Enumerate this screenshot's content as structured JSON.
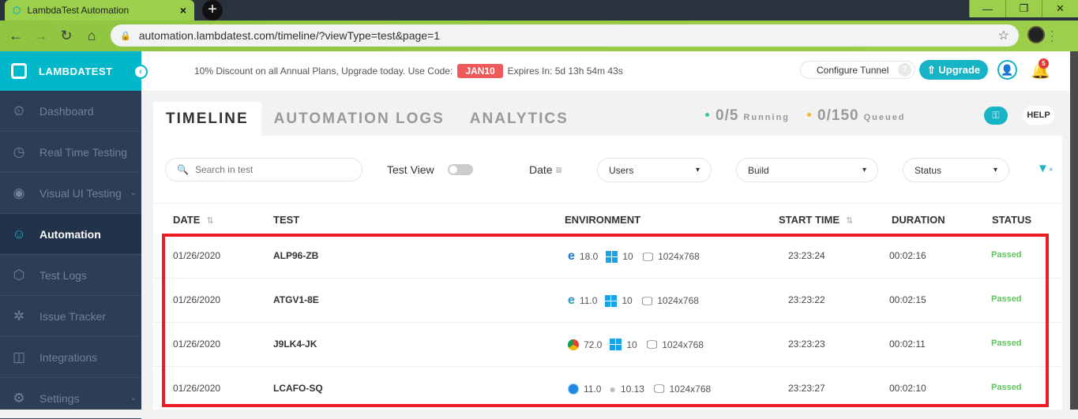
{
  "browser": {
    "tab_title": "LambdaTest Automation",
    "tab_close": "×",
    "new_tab": "+",
    "url": "automation.lambdatest.com/timeline/?viewType=test&page=1",
    "window_controls": {
      "minimize": "—",
      "restore": "❐",
      "close": "✕"
    }
  },
  "sidebar": {
    "brand": "LAMBDATEST",
    "collapse_icon": "‹",
    "items": [
      {
        "label": "Dashboard",
        "icon": "⏲",
        "active": false
      },
      {
        "label": "Real Time Testing",
        "icon": "◷",
        "active": false
      },
      {
        "label": "Visual UI Testing",
        "icon": "◉",
        "active": false,
        "expandable": true
      },
      {
        "label": "Automation",
        "icon": "☺",
        "active": true
      },
      {
        "label": "Test Logs",
        "icon": "⬡",
        "active": false
      },
      {
        "label": "Issue Tracker",
        "icon": "✲",
        "active": false
      },
      {
        "label": "Integrations",
        "icon": "◫",
        "active": false
      },
      {
        "label": "Settings",
        "icon": "⚙",
        "active": false,
        "expandable": true
      }
    ],
    "chevron": "⌄"
  },
  "topbar": {
    "promo_text": "10% Discount on all Annual Plans, Upgrade today. Use Code:",
    "promo_code": "JAN10",
    "expires": "Expires In: 5d 13h 54m 43s",
    "configure_tunnel": "Configure Tunnel",
    "tunnel_help": "?",
    "upgrade": "⇧ Upgrade",
    "notification_count": "5"
  },
  "main": {
    "tabs": [
      {
        "label": "TIMELINE",
        "active": true
      },
      {
        "label": "AUTOMATION LOGS",
        "active": false
      },
      {
        "label": "ANALYTICS",
        "active": false
      }
    ],
    "running": {
      "value": "0/5",
      "label": "Running",
      "color": "#2ecc9a"
    },
    "queued": {
      "value": "0/150",
      "label": "Queued",
      "color": "#f5b82e"
    },
    "help": "HELP",
    "search_placeholder": "Search in test",
    "test_view_label": "Test View",
    "test_view_on": false,
    "date_label": "Date",
    "filters": {
      "users": "Users",
      "build": "Build",
      "status": "Status"
    },
    "clear_filter": "×"
  },
  "table": {
    "headers": {
      "date": "DATE",
      "test": "TEST",
      "environment": "ENVIRONMENT",
      "start_time": "START TIME",
      "duration": "DURATION",
      "status": "STATUS"
    },
    "sort_icon": "⇅",
    "rows": [
      {
        "date": "01/26/2020",
        "test": "ALP96-ZB",
        "browser": "Edge",
        "browser_version": "18.0",
        "os": "Windows",
        "os_version": "10",
        "resolution": "1024x768",
        "start_time": "23:23:24",
        "duration": "00:02:16",
        "status": "Passed"
      },
      {
        "date": "01/26/2020",
        "test": "ATGV1-8E",
        "browser": "Internet Explorer",
        "browser_version": "11.0",
        "os": "Windows",
        "os_version": "10",
        "resolution": "1024x768",
        "start_time": "23:23:22",
        "duration": "00:02:15",
        "status": "Passed"
      },
      {
        "date": "01/26/2020",
        "test": "J9LK4-JK",
        "browser": "Chrome",
        "browser_version": "72.0",
        "os": "Windows",
        "os_version": "10",
        "resolution": "1024x768",
        "start_time": "23:23:23",
        "duration": "00:02:11",
        "status": "Passed"
      },
      {
        "date": "01/26/2020",
        "test": "LCAFO-SQ",
        "browser": "Safari",
        "browser_version": "11.0",
        "os": "macOS",
        "os_version": "10.13",
        "resolution": "1024x768",
        "start_time": "23:23:27",
        "duration": "00:02:10",
        "status": "Passed"
      }
    ]
  },
  "colors": {
    "accent": "#16b4c5",
    "passed": "#5cc75c",
    "promo_code": "#f05959",
    "highlight": "#ed1c24"
  }
}
